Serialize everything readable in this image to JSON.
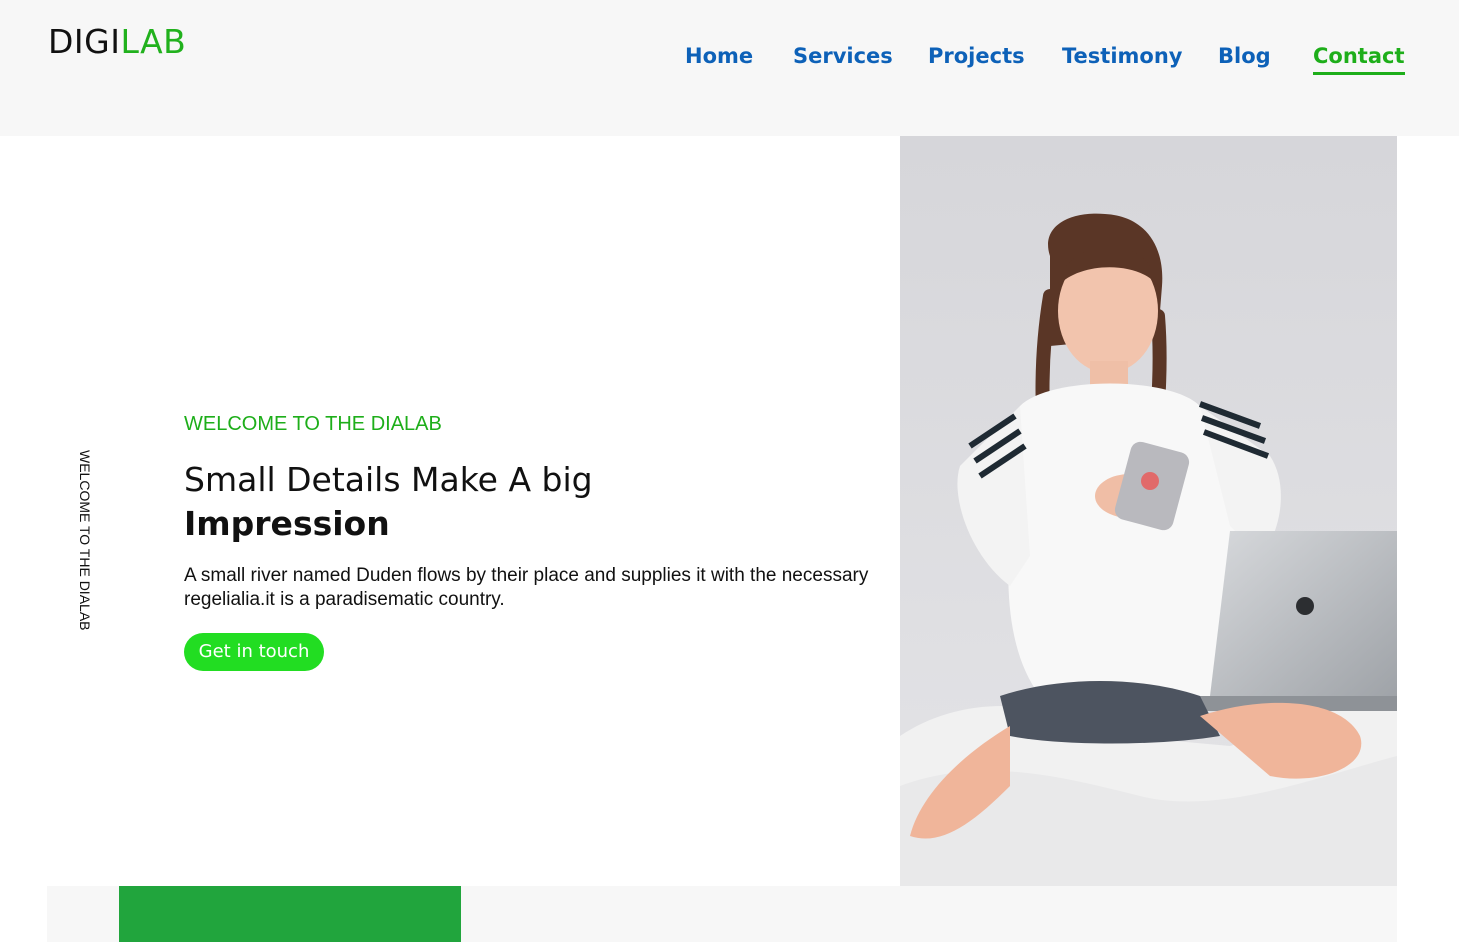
{
  "header": {
    "logo": {
      "part1": "DIGI",
      "part2": "LAB"
    },
    "nav": [
      {
        "label": "Home"
      },
      {
        "label": "Services"
      },
      {
        "label": "Projects"
      },
      {
        "label": "Testimony"
      },
      {
        "label": "Blog"
      },
      {
        "label": "Contact",
        "active": true
      }
    ]
  },
  "hero": {
    "side_label": "WELCOME TO THE DIALAB",
    "eyebrow": "WELCOME TO THE DIALAB",
    "headline_line1": "Small Details Make A big",
    "headline_line2": "Impression",
    "description": "A small river named Duden flows by their place and supplies it with the necessary regelialia.it is a paradisematic country.",
    "cta_label": "Get in touch",
    "photo_icon": "photo-woman-with-phone-and-laptop"
  },
  "colors": {
    "accent_green": "#1eae1a",
    "nav_blue": "#0d61b8",
    "button_green": "#22dd22",
    "block_green": "#21a53d"
  }
}
